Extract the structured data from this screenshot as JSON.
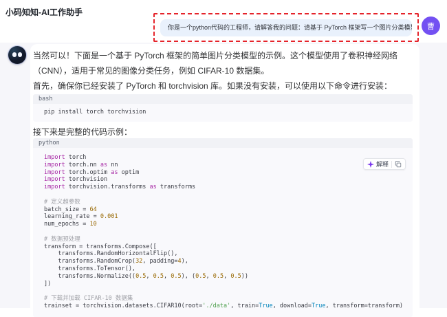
{
  "header": {
    "title": "小码知知-AI工作助手"
  },
  "user": {
    "message": "你是一个python代码的工程师，请解答我的问题：请基于 PyTorch 框架写一个图片分类模型",
    "avatar_text": "曹"
  },
  "assistant": {
    "intro": "当然可以！下面是一个基于 PyTorch 框架的简单图片分类模型的示例。这个模型使用了卷积神经网络（CNN），适用于常见的图像分类任务，例如 CIFAR-10 数据集。",
    "install_note": "首先，确保你已经安装了 PyTorch 和 torchvision 库。如果没有安装，可以使用以下命令进行安装：",
    "next_note": "接下来是完整的代码示例：",
    "bash_block": {
      "lang": "bash",
      "lines": [
        [
          [
            "p",
            "pip install torch torchvision"
          ]
        ]
      ]
    },
    "python_block": {
      "lang": "python",
      "toolbar": {
        "explain_label": "解释",
        "copy_icon": "copy"
      },
      "lines": [
        [
          [
            "k",
            "import"
          ],
          [
            "p",
            " torch"
          ]
        ],
        [
          [
            "k",
            "import"
          ],
          [
            "p",
            " torch.nn "
          ],
          [
            "k",
            "as"
          ],
          [
            "p",
            " nn"
          ]
        ],
        [
          [
            "k",
            "import"
          ],
          [
            "p",
            " torch.optim "
          ],
          [
            "k",
            "as"
          ],
          [
            "p",
            " optim"
          ]
        ],
        [
          [
            "k",
            "import"
          ],
          [
            "p",
            " torchvision"
          ]
        ],
        [
          [
            "k",
            "import"
          ],
          [
            "p",
            " torchvision.transforms "
          ],
          [
            "k",
            "as"
          ],
          [
            "p",
            " transforms"
          ]
        ],
        [],
        [
          [
            "c",
            "# 定义超参数"
          ]
        ],
        [
          [
            "p",
            "batch_size = "
          ],
          [
            "n",
            "64"
          ]
        ],
        [
          [
            "p",
            "learning_rate = "
          ],
          [
            "n",
            "0.001"
          ]
        ],
        [
          [
            "p",
            "num_epochs = "
          ],
          [
            "n",
            "10"
          ]
        ],
        [],
        [
          [
            "c",
            "# 数据预处理"
          ]
        ],
        [
          [
            "p",
            "transform = transforms.Compose(["
          ]
        ],
        [
          [
            "p",
            "    transforms.RandomHorizontalFlip(),"
          ]
        ],
        [
          [
            "p",
            "    transforms.RandomCrop("
          ],
          [
            "n",
            "32"
          ],
          [
            "p",
            ", padding="
          ],
          [
            "n",
            "4"
          ],
          [
            "p",
            "),"
          ]
        ],
        [
          [
            "p",
            "    transforms.ToTensor(),"
          ]
        ],
        [
          [
            "p",
            "    transforms.Normalize(("
          ],
          [
            "n",
            "0.5"
          ],
          [
            "p",
            ", "
          ],
          [
            "n",
            "0.5"
          ],
          [
            "p",
            ", "
          ],
          [
            "n",
            "0.5"
          ],
          [
            "p",
            "), ("
          ],
          [
            "n",
            "0.5"
          ],
          [
            "p",
            ", "
          ],
          [
            "n",
            "0.5"
          ],
          [
            "p",
            ", "
          ],
          [
            "n",
            "0.5"
          ],
          [
            "p",
            "))"
          ]
        ],
        [
          [
            "p",
            "])"
          ]
        ],
        [],
        [
          [
            "c",
            "# 下载并加载 CIFAR-10 数据集"
          ]
        ],
        [
          [
            "p",
            "trainset = torchvision.datasets.CIFAR10(root="
          ],
          [
            "s",
            "'./data'"
          ],
          [
            "p",
            ", train="
          ],
          [
            "l",
            "True"
          ],
          [
            "p",
            ", download="
          ],
          [
            "l",
            "True"
          ],
          [
            "p",
            ", transform=transform)"
          ]
        ]
      ]
    }
  },
  "colors": {
    "page_background": "#f6f6fa",
    "card_background": "#ffffff",
    "user_bubble": "#e9f1fc",
    "annotation_red": "#e5242b",
    "accent_purple": "#7350f2",
    "code_keyword": "#a626a4",
    "code_number": "#986801",
    "code_string": "#50a14f",
    "code_literal": "#0184bb",
    "code_comment": "#a0a1a7"
  }
}
